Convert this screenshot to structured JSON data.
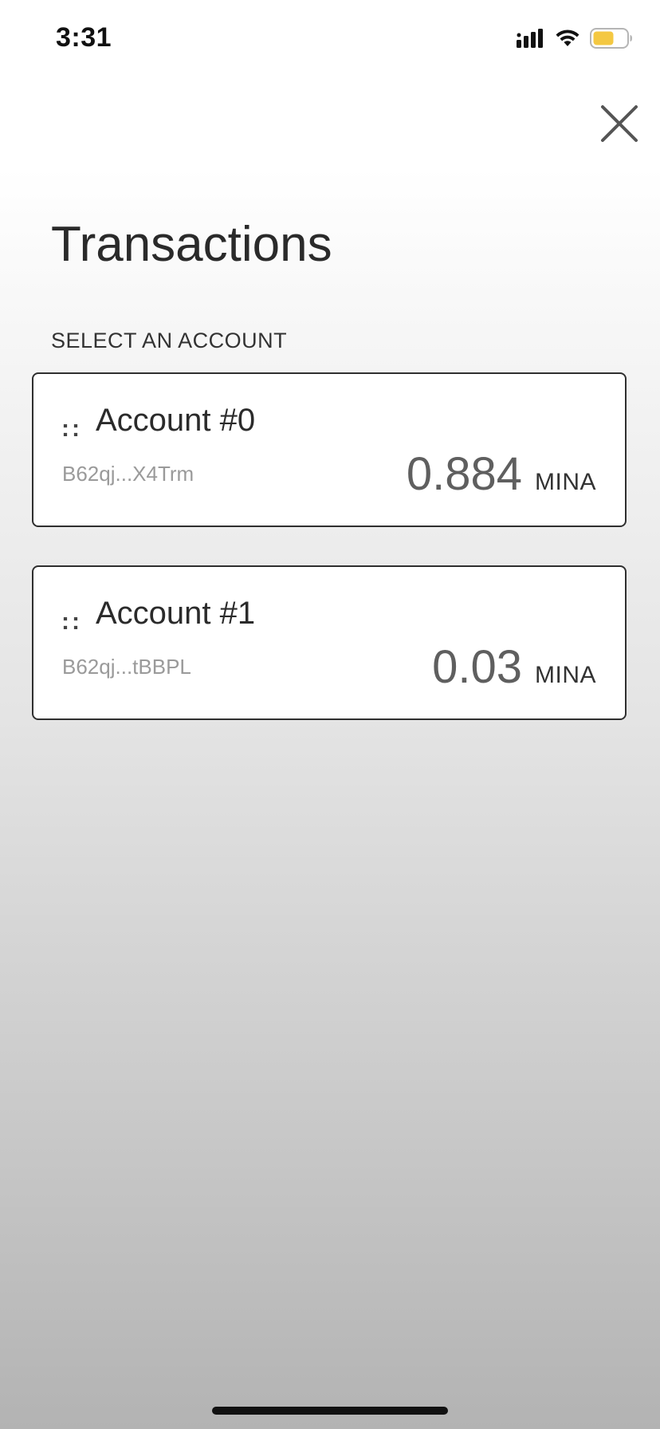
{
  "status_bar": {
    "time": "3:31",
    "icons": [
      "cellular-signal-icon",
      "wifi-icon",
      "battery-icon"
    ],
    "battery_color": "#f4c842"
  },
  "header": {
    "close_icon": "close-icon"
  },
  "main": {
    "title": "Transactions",
    "section_label": "SELECT AN ACCOUNT",
    "accounts": [
      {
        "handle": "::",
        "name": "Account #0",
        "address": "B62qj...X4Trm",
        "balance": "0.884",
        "unit": "MINA"
      },
      {
        "handle": "::",
        "name": "Account #1",
        "address": "B62qj...tBBPL",
        "balance": "0.03",
        "unit": "MINA"
      }
    ]
  }
}
